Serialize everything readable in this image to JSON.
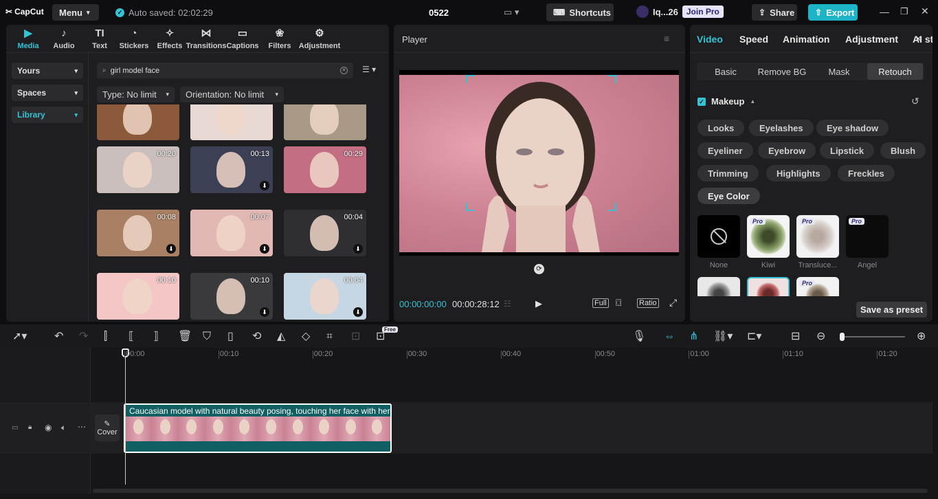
{
  "app": {
    "logo": "CapCut",
    "menu": "Menu",
    "autosave": "Auto saved: 02:02:29",
    "project": "0522"
  },
  "header": {
    "shortcuts": "Shortcuts",
    "user": "Iq...26",
    "join_pro": "Join Pro",
    "share": "Share",
    "export": "Export"
  },
  "toolbar": [
    {
      "label": "Media",
      "icon": "▶"
    },
    {
      "label": "Audio",
      "icon": "♪"
    },
    {
      "label": "Text",
      "icon": "TI"
    },
    {
      "label": "Stickers",
      "icon": "◔"
    },
    {
      "label": "Effects",
      "icon": "✧"
    },
    {
      "label": "Transitions",
      "icon": "⋈"
    },
    {
      "label": "Captions",
      "icon": "▭"
    },
    {
      "label": "Filters",
      "icon": "❀"
    },
    {
      "label": "Adjustment",
      "icon": "⚙"
    }
  ],
  "sidebar": {
    "yours": "Yours",
    "spaces": "Spaces",
    "library": "Library"
  },
  "search": {
    "value": "girl model face"
  },
  "filters": {
    "type": "Type: No limit",
    "orientation": "Orientation: No limit"
  },
  "media": [
    {
      "duration": "",
      "download": false
    },
    {
      "duration": "",
      "download": false
    },
    {
      "duration": "",
      "download": false
    },
    {
      "duration": "00:20",
      "download": false
    },
    {
      "duration": "00:13",
      "download": true
    },
    {
      "duration": "00:29",
      "download": false
    },
    {
      "duration": "00:08",
      "download": true
    },
    {
      "duration": "00:07",
      "download": true
    },
    {
      "duration": "00:04",
      "download": true
    },
    {
      "duration": "00:10",
      "download": false
    },
    {
      "duration": "00:10",
      "download": true
    },
    {
      "duration": "00:04",
      "download": true
    }
  ],
  "player": {
    "title": "Player",
    "current": "00:00:00:00",
    "total": "00:00:28:12",
    "full": "Full",
    "ratio": "Ratio"
  },
  "right": {
    "tabs": [
      "Video",
      "Speed",
      "Animation",
      "Adjustment",
      "AI st"
    ],
    "subtabs": [
      "Basic",
      "Remove BG",
      "Mask",
      "Retouch"
    ],
    "section": "Makeup",
    "pills": [
      "Looks",
      "Eyelashes",
      "Eye shadow",
      "Eyeliner",
      "Eyebrow",
      "Lipstick",
      "Blush",
      "Trimming",
      "Highlights",
      "Freckles",
      "Eye Color"
    ],
    "swatches": [
      {
        "label": "None",
        "pro": false
      },
      {
        "label": "Kiwi",
        "pro": true
      },
      {
        "label": "Transluce...",
        "pro": true
      },
      {
        "label": "Angel",
        "pro": true
      }
    ],
    "pro_label": "Pro",
    "save_preset": "Save as preset"
  },
  "timeline": {
    "free_badge": "Free",
    "ruler": [
      "00:00",
      "00:10",
      "00:20",
      "00:30",
      "00:40",
      "00:50",
      "01:00",
      "01:10",
      "01:20"
    ],
    "clip_title": "Caucasian model with natural beauty posing, touching her face with her",
    "cover": "Cover"
  },
  "colors": {
    "accent": "#34c3d4",
    "export": "#1db4c8",
    "clip_bg": "#0f5f63"
  }
}
